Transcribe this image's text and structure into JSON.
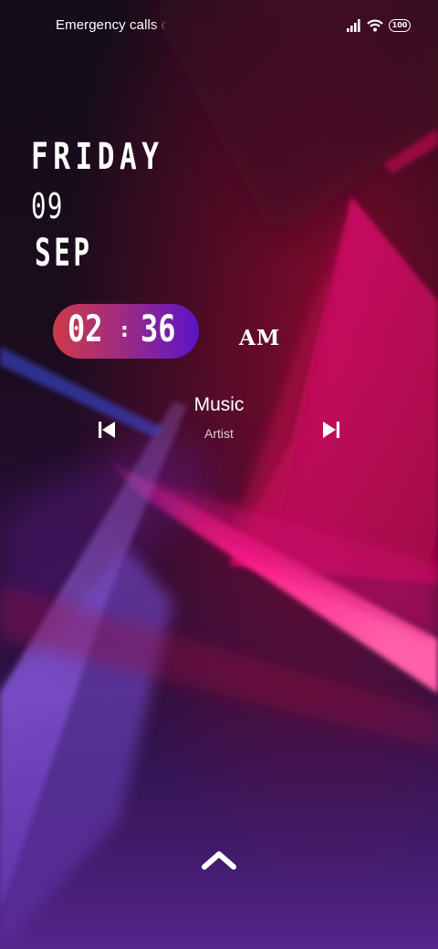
{
  "status_bar": {
    "carrier_text": "Emergency calls only",
    "battery_level": "100",
    "signal_icon": "signal-bars-icon",
    "wifi_icon": "wifi-icon"
  },
  "lock_screen": {
    "day_name": "FRIDAY",
    "day_number": "09",
    "month": "SEP",
    "clock": {
      "hours": "02",
      "separator": ":",
      "minutes": "36",
      "meridiem": "AM"
    }
  },
  "media": {
    "title": "Music",
    "artist": "Artist",
    "prev_icon": "skip-previous-icon",
    "next_icon": "skip-next-icon"
  },
  "unlock_icon": "chevron-up-icon",
  "colors": {
    "accent_pink": "#e0105a",
    "accent_purple": "#7a3cd8",
    "clock_gradient_start": "#cf3a4a",
    "clock_gradient_end": "#5a14c8"
  }
}
